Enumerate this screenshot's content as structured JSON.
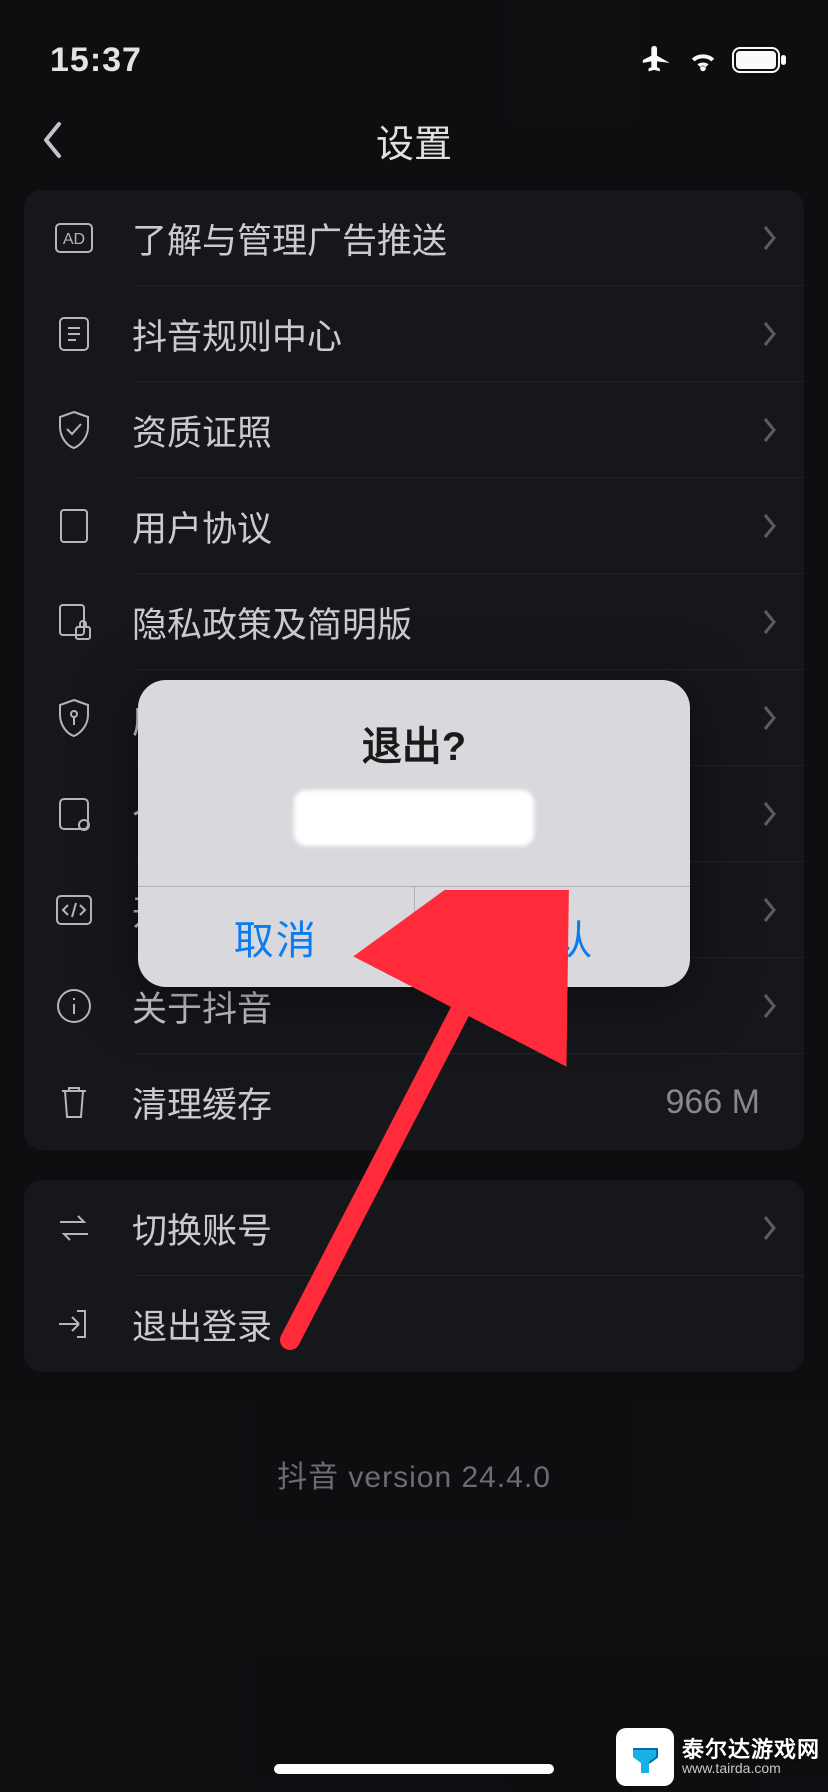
{
  "status": {
    "time": "15:37"
  },
  "nav": {
    "title": "设置"
  },
  "group1": [
    {
      "label": "了解与管理广告推送",
      "icon": "ad"
    },
    {
      "label": "抖音规则中心",
      "icon": "rules"
    },
    {
      "label": "资质证照",
      "icon": "shield-check"
    },
    {
      "label": "用户协议",
      "icon": "doc"
    },
    {
      "label": "隐私政策及简明版",
      "icon": "doc-lock"
    },
    {
      "label": "应用权限",
      "icon": "shield-key"
    },
    {
      "label": "个",
      "icon": "list"
    },
    {
      "label": "开",
      "icon": "code"
    },
    {
      "label": "关于抖音",
      "icon": "info"
    },
    {
      "label": "清理缓存",
      "icon": "trash",
      "value": "966 M",
      "no_chevron": true
    }
  ],
  "group2": [
    {
      "label": "切换账号",
      "icon": "swap"
    },
    {
      "label": "退出登录",
      "icon": "exit",
      "no_chevron": true
    }
  ],
  "version_text": "抖音 version 24.4.0",
  "dialog": {
    "title": "退出?",
    "cancel": "取消",
    "confirm": "确认"
  },
  "watermark": {
    "site_name": "泰尔达游戏网",
    "url": "www.tairda.com"
  }
}
